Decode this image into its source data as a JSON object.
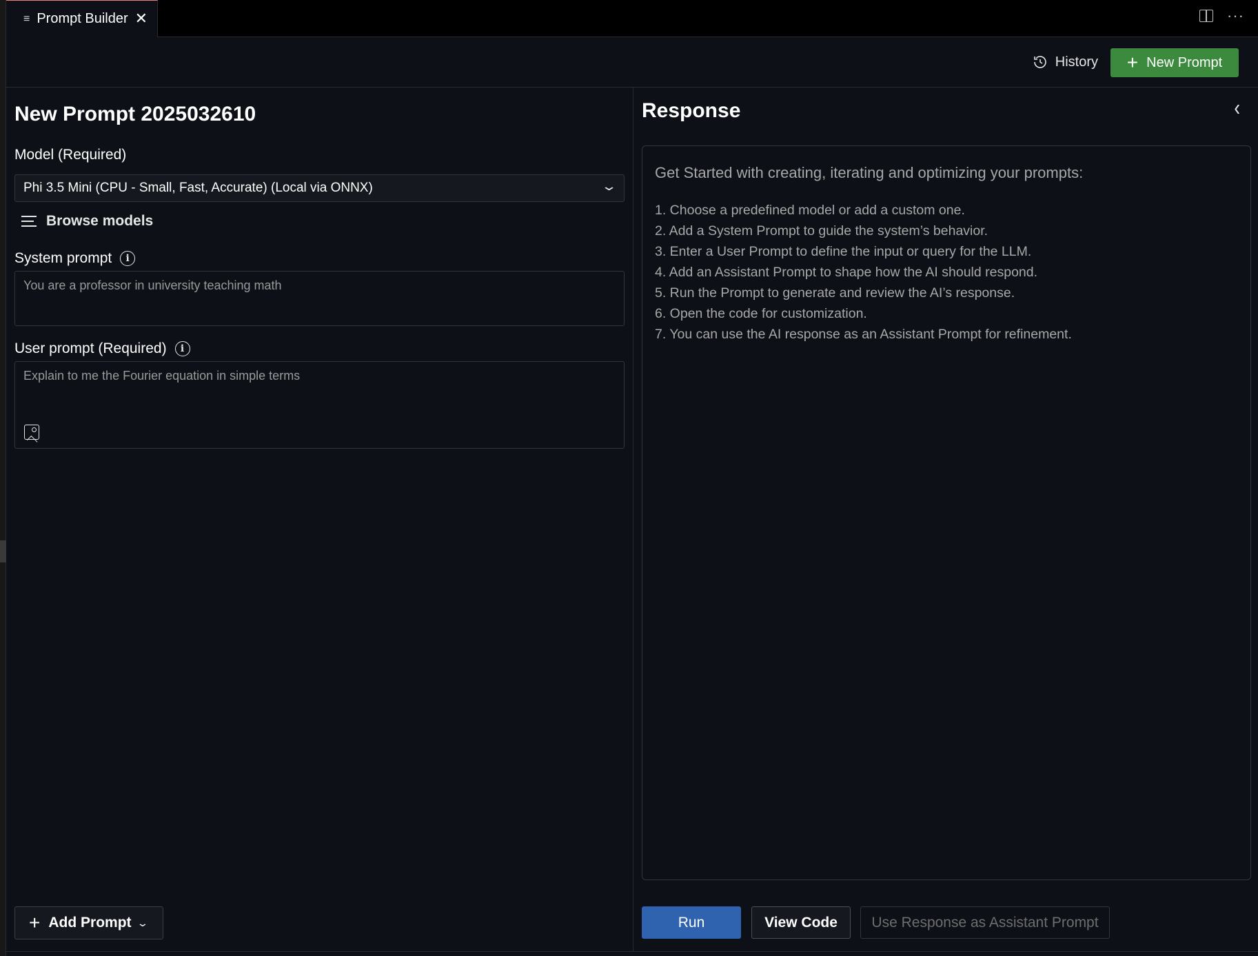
{
  "tab": {
    "title": "Prompt Builder",
    "menu_glyph": "≡",
    "close_glyph": "✕",
    "more_glyph": "···"
  },
  "toolbar": {
    "history_label": "History",
    "new_prompt_label": "New Prompt",
    "new_prompt_color": "#3b8a3e"
  },
  "left": {
    "prompt_title": "New Prompt 2025032610",
    "model_label": "Model (Required)",
    "model_value": "Phi 3.5 Mini (CPU - Small, Fast, Accurate) (Local via ONNX)",
    "browse_label": "Browse models",
    "system_label": "System prompt",
    "system_placeholder": "You are a professor in university teaching math",
    "user_label": "User prompt (Required)",
    "user_placeholder": "Explain to me the Fourier equation in simple terms",
    "add_prompt_label": "Add Prompt"
  },
  "right": {
    "response_title": "Response",
    "collapse_glyph": "‹",
    "heading": "Get Started with creating, iterating and optimizing your prompts:",
    "steps": [
      "1. Choose a predefined model or add a custom one.",
      "2. Add a System Prompt to guide the system’s behavior.",
      "3. Enter a User Prompt to define the input or query for the LLM.",
      "4. Add an Assistant Prompt to shape how the AI should respond.",
      "5. Run the Prompt to generate and review the AI’s response.",
      "6. Open the code for customization.",
      "7. You can use the AI response as an Assistant Prompt for refinement."
    ],
    "run_label": "Run",
    "run_color": "#2f63b0",
    "view_code_label": "View Code",
    "use_response_label": "Use Response as Assistant Prompt"
  }
}
